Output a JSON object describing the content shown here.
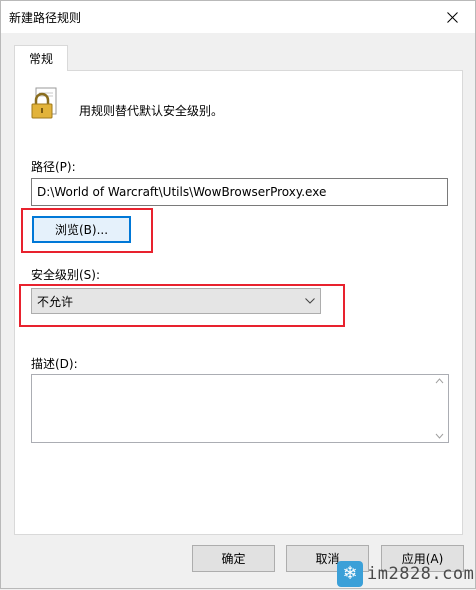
{
  "window": {
    "title": "新建路径规则",
    "close_icon": "close-icon"
  },
  "tabs": [
    {
      "label": "常规"
    }
  ],
  "description": "用规则替代默认安全级别。",
  "path": {
    "label": "路径(P):",
    "value": "D:\\World of Warcraft\\Utils\\WowBrowserProxy.exe"
  },
  "browse": {
    "label": "浏览(B)..."
  },
  "security_level": {
    "label": "安全级别(S):",
    "selected": "不允许"
  },
  "notes": {
    "label": "描述(D):",
    "value": ""
  },
  "footer": {
    "ok": "确定",
    "cancel": "取消",
    "apply": "应用(A)"
  },
  "watermark": {
    "text": "im2828.com"
  },
  "colors": {
    "highlight": "#e8222e",
    "accent": "#0078d7"
  }
}
